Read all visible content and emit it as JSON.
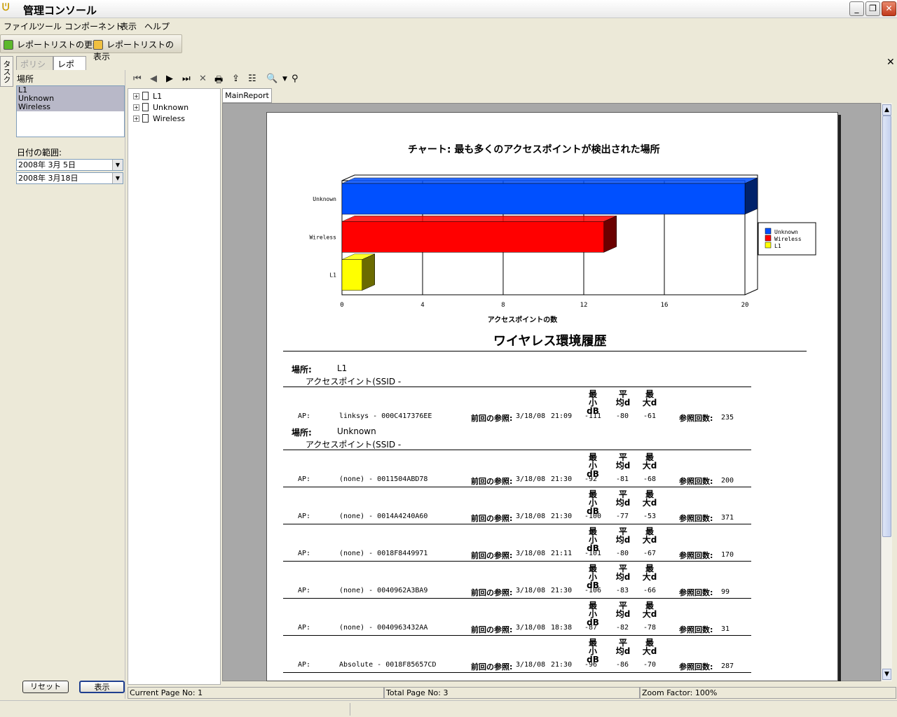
{
  "window": {
    "title": "管理コンソール",
    "app_icon": "u-logo-icon"
  },
  "menu": [
    "ファイル",
    "ツール",
    "コンポーネント",
    "表示",
    "ヘルプ"
  ],
  "toolbar": {
    "refresh_label": "レポートリストの更新",
    "show_label": "レポートリストの表示"
  },
  "side_tab": "タスク",
  "tabs": {
    "policy": "ポリシー",
    "report": "レポート"
  },
  "left": {
    "location_label": "場所",
    "locations": [
      "L1",
      "Unknown",
      "Wireless"
    ],
    "date_range_label": "日付の範囲:",
    "date_from": "2008年  3月  5日",
    "date_to": "2008年  3月18日",
    "reset_button": "リセット",
    "show_button": "表示"
  },
  "tree": [
    "L1",
    "Unknown",
    "Wireless"
  ],
  "report_tab": "MainReport",
  "report": {
    "chart_title": "チャート: 最も多くのアクセスポイントが検出された場所",
    "section_title": "ワイヤレス環境履歴",
    "location_label": "場所:",
    "ap_header": "アクセスポイント(SSID -",
    "col_min": [
      "最",
      "小dB"
    ],
    "col_avg": [
      "平",
      "均d"
    ],
    "col_max": [
      "最",
      "大d"
    ],
    "ap_label": "AP:",
    "last_ref_label": "前回の参照:",
    "ref_count_label": "参照回数:",
    "groups": [
      {
        "location": "L1",
        "rows": [
          {
            "ap": "linksys - 000C417376EE",
            "date": "3/18/08",
            "time": "21:09",
            "min": "-111",
            "avg": "-80",
            "max": "-61",
            "count": "235"
          }
        ]
      },
      {
        "location": "Unknown",
        "rows": [
          {
            "ap": "(none) - 0011504ABD78",
            "date": "3/18/08",
            "time": "21:30",
            "min": "-92",
            "avg": "-81",
            "max": "-68",
            "count": "200"
          },
          {
            "ap": "(none) - 0014A4240A60",
            "date": "3/18/08",
            "time": "21:30",
            "min": "-100",
            "avg": "-77",
            "max": "-53",
            "count": "371"
          },
          {
            "ap": "(none) - 0018F8449971",
            "date": "3/18/08",
            "time": "21:11",
            "min": "-101",
            "avg": "-80",
            "max": "-67",
            "count": "170"
          },
          {
            "ap": "(none) - 0040962A3BA9",
            "date": "3/18/08",
            "time": "21:30",
            "min": "-106",
            "avg": "-83",
            "max": "-66",
            "count": "99"
          },
          {
            "ap": "(none) - 0040963432AA",
            "date": "3/18/08",
            "time": "18:38",
            "min": "-87",
            "avg": "-82",
            "max": "-78",
            "count": "31"
          },
          {
            "ap": "Absolute - 0018F85657CD",
            "date": "3/18/08",
            "time": "21:30",
            "min": "-96",
            "avg": "-86",
            "max": "-70",
            "count": "287"
          }
        ]
      }
    ]
  },
  "chart_data": {
    "type": "bar",
    "orientation": "horizontal",
    "categories": [
      "Unknown",
      "Wireless",
      "L1"
    ],
    "values": [
      20,
      13,
      1
    ],
    "colors": [
      "#0050ff",
      "#ff0000",
      "#ffff00"
    ],
    "xlabel": "アクセスポイントの数",
    "xticks": [
      0,
      4,
      8,
      12,
      16,
      20
    ],
    "xlim": [
      0,
      20
    ],
    "legend": {
      "position": "right",
      "entries": [
        "Unknown",
        "Wireless",
        "L1"
      ]
    },
    "grid": true
  },
  "status": {
    "current_page": "Current Page No: 1",
    "total_page": "Total Page No: 3",
    "zoom": "Zoom Factor: 100%"
  }
}
